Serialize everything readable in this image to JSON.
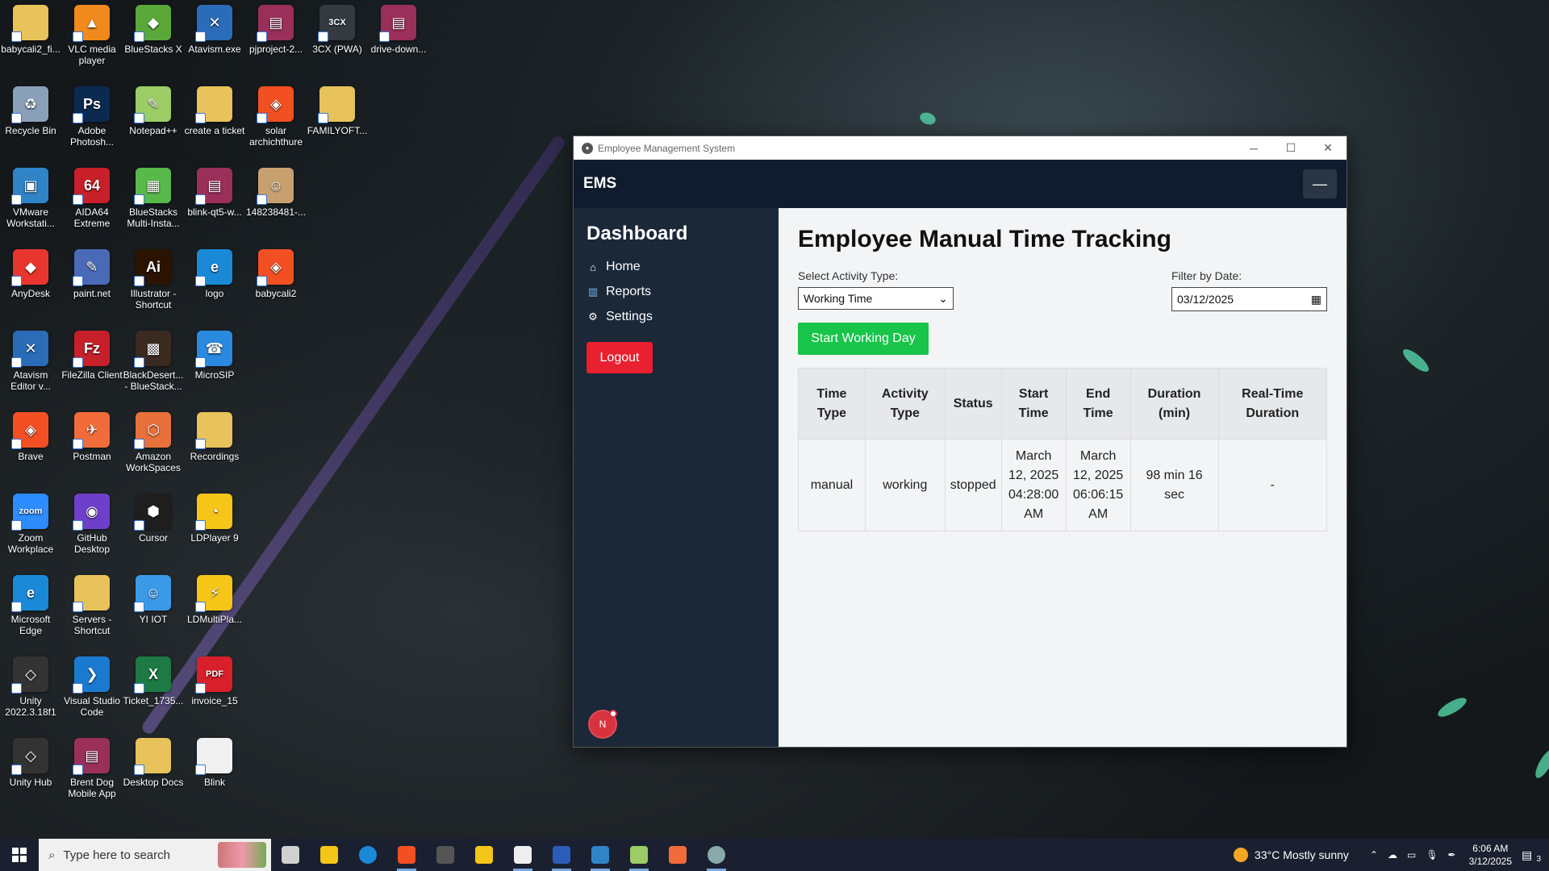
{
  "desktop": {
    "icons": [
      {
        "label": "babycali2_fi...",
        "color": "#e8c25a",
        "glyph": ""
      },
      {
        "label": "VLC media player",
        "color": "#f08a1c",
        "glyph": "▲"
      },
      {
        "label": "BlueStacks X",
        "color": "#5aa83a",
        "glyph": "◆"
      },
      {
        "label": "Atavism.exe",
        "color": "#2b6cb8",
        "glyph": "✕"
      },
      {
        "label": "pjproject-2...",
        "color": "#9a2f5a",
        "glyph": "▤"
      },
      {
        "label": "3CX (PWA)",
        "color": "#333a40",
        "glyph": "3CX"
      },
      {
        "label": "drive-down...",
        "color": "#9a2f5a",
        "glyph": "▤"
      },
      {
        "label": "Recycle Bin",
        "color": "#8aa0b8",
        "glyph": "♻"
      },
      {
        "label": "Adobe Photosh...",
        "color": "#0a2a50",
        "glyph": "Ps"
      },
      {
        "label": "Notepad++",
        "color": "#9ccc65",
        "glyph": "✎"
      },
      {
        "label": "create a ticket",
        "color": "#e8c25a",
        "glyph": ""
      },
      {
        "label": "solar archichthure",
        "color": "#f25022",
        "glyph": "◈"
      },
      {
        "label": "FAMILYOFT...",
        "color": "#e8c25a",
        "glyph": ""
      },
      {
        "label": "VMware Workstati...",
        "color": "#2f84c8",
        "glyph": "▣"
      },
      {
        "label": "AIDA64 Extreme",
        "color": "#c8202a",
        "glyph": "64"
      },
      {
        "label": "BlueStacks Multi-Insta...",
        "color": "#59b84a",
        "glyph": "▦"
      },
      {
        "label": "blink-qt5-w...",
        "color": "#9a2f5a",
        "glyph": "▤"
      },
      {
        "label": "148238481-...",
        "color": "#c8a070",
        "glyph": "☺"
      },
      {
        "label": "AnyDesk",
        "color": "#e8362f",
        "glyph": "◆"
      },
      {
        "label": "paint.net",
        "color": "#4a6ab8",
        "glyph": "✎"
      },
      {
        "label": "Illustrator - Shortcut",
        "color": "#2a1400",
        "glyph": "Ai"
      },
      {
        "label": "logo",
        "color": "#1a8ad8",
        "glyph": "e"
      },
      {
        "label": "babycali2",
        "color": "#f25022",
        "glyph": "◈"
      },
      {
        "label": "Atavism Editor v...",
        "color": "#2b6cb8",
        "glyph": "✕"
      },
      {
        "label": "FileZilla Client",
        "color": "#c8202a",
        "glyph": "Fz"
      },
      {
        "label": "BlackDesert... - BlueStack...",
        "color": "#3a2a20",
        "glyph": "▩"
      },
      {
        "label": "MicroSIP",
        "color": "#2a8ae0",
        "glyph": "☎"
      },
      {
        "label": "Brave",
        "color": "#f25022",
        "glyph": "◈"
      },
      {
        "label": "Postman",
        "color": "#f26b3a",
        "glyph": "✈"
      },
      {
        "label": "Amazon WorkSpaces",
        "color": "#e8703a",
        "glyph": "⬡"
      },
      {
        "label": "Recordings",
        "color": "#e8c25a",
        "glyph": ""
      },
      {
        "label": "Zoom Workplace",
        "color": "#2d8cff",
        "glyph": "zoom"
      },
      {
        "label": "GitHub Desktop",
        "color": "#6e40c9",
        "glyph": "◉"
      },
      {
        "label": "Cursor",
        "color": "#1e1e1e",
        "glyph": "⬢"
      },
      {
        "label": "LDPlayer 9",
        "color": "#f5c518",
        "glyph": "◔"
      },
      {
        "label": "Microsoft Edge",
        "color": "#1a8ad8",
        "glyph": "e"
      },
      {
        "label": "Servers - Shortcut",
        "color": "#e8c25a",
        "glyph": ""
      },
      {
        "label": "YI IOT",
        "color": "#3a9ae8",
        "glyph": "☺"
      },
      {
        "label": "LDMultiPla...",
        "color": "#f5c518",
        "glyph": "⚡"
      },
      {
        "label": "Unity 2022.3.18f1",
        "color": "#333",
        "glyph": "◇"
      },
      {
        "label": "Visual Studio Code",
        "color": "#1a7ad0",
        "glyph": "❯"
      },
      {
        "label": "Ticket_1735...",
        "color": "#1d7a44",
        "glyph": "X"
      },
      {
        "label": "invoice_15",
        "color": "#d8202a",
        "glyph": "PDF"
      },
      {
        "label": "Unity Hub",
        "color": "#333",
        "glyph": "◇"
      },
      {
        "label": "Brent Dog Mobile App",
        "color": "#9a2f5a",
        "glyph": "▤"
      },
      {
        "label": "Desktop Docs",
        "color": "#e8c25a",
        "glyph": ""
      },
      {
        "label": "Blink",
        "color": "#f0f0f0",
        "glyph": ""
      }
    ]
  },
  "window": {
    "title": "Employee Management System",
    "controls": {
      "minimize": "─",
      "maximize": "☐",
      "close": "✕"
    },
    "navbar": {
      "brand": "EMS",
      "menu_glyph": "—"
    },
    "sidebar": {
      "heading": "Dashboard",
      "items": [
        {
          "icon": "home-icon",
          "glyph": "⌂",
          "label": "Home"
        },
        {
          "icon": "chart-icon",
          "glyph": "▥",
          "label": "Reports"
        },
        {
          "icon": "gear-icon",
          "glyph": "⚙",
          "label": "Settings"
        }
      ],
      "logout_label": "Logout",
      "avatar_initial": "N"
    },
    "main": {
      "title": "Employee Manual Time Tracking",
      "activity_label": "Select Activity Type:",
      "activity_value": "Working Time",
      "date_label": "Filter by Date:",
      "date_value": "03/12/2025",
      "start_button": "Start Working Day",
      "table": {
        "headers": [
          "Time Type",
          "Activity Type",
          "Status",
          "Start Time",
          "End Time",
          "Duration (min)",
          "Real-Time Duration"
        ],
        "rows": [
          [
            "manual",
            "working",
            "stopped",
            "March 12, 2025 04:28:00 AM",
            "March 12, 2025 06:06:15 AM",
            "98 min 16 sec",
            "-"
          ]
        ]
      }
    }
  },
  "taskbar": {
    "search_placeholder": "Type here to search",
    "apps": [
      {
        "name": "task-view",
        "color": "#d0d0d0"
      },
      {
        "name": "file-explorer",
        "color": "#f5c518"
      },
      {
        "name": "edge",
        "color": "#1a8ad8"
      },
      {
        "name": "brave",
        "color": "#f25022"
      },
      {
        "name": "3cx",
        "color": "#555"
      },
      {
        "name": "ldplayer",
        "color": "#f5c518"
      },
      {
        "name": "cursor",
        "color": "#eee"
      },
      {
        "name": "word",
        "color": "#2b5cb8"
      },
      {
        "name": "vmware",
        "color": "#2f84c8"
      },
      {
        "name": "notepad",
        "color": "#9ccc65"
      },
      {
        "name": "postman",
        "color": "#f26b3a"
      },
      {
        "name": "ems-app",
        "color": "#8aa"
      }
    ],
    "weather": "33°C  Mostly sunny",
    "time": "6:06 AM",
    "date": "3/12/2025",
    "notification_count": "3"
  }
}
